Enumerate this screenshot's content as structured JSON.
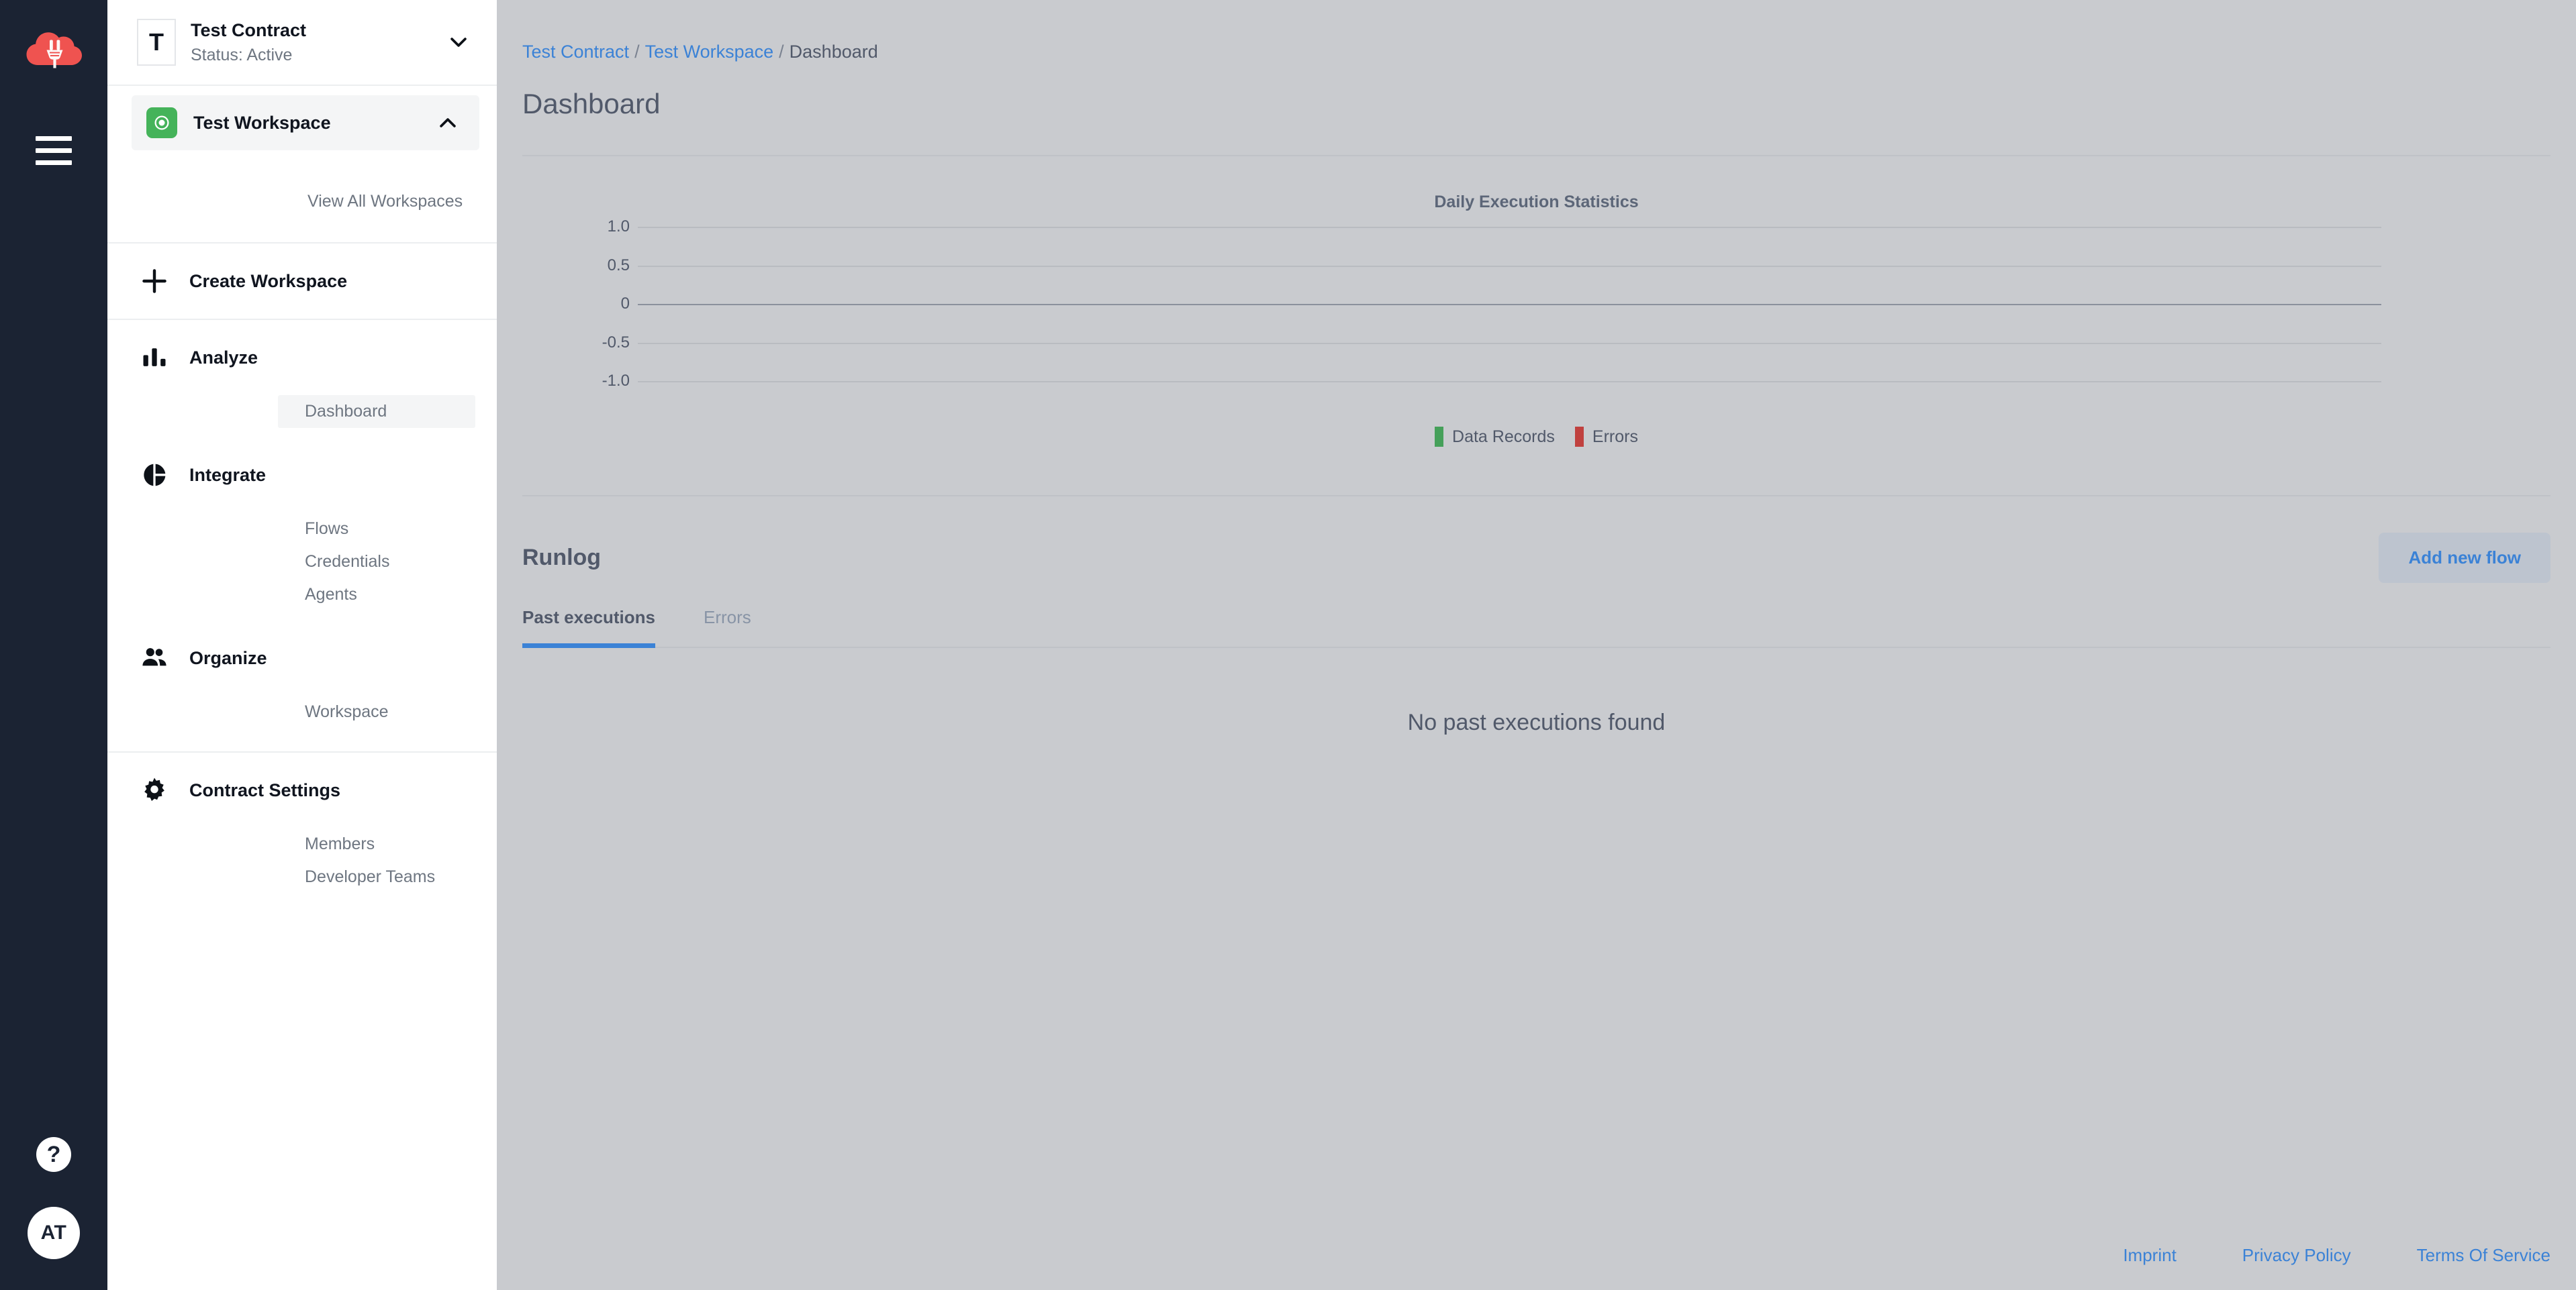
{
  "rail": {
    "logo_icon": "cloud-plug-logo-icon",
    "menu_icon": "hamburger-menu-icon",
    "help_label": "?",
    "avatar_initials": "AT"
  },
  "sidebar": {
    "contract": {
      "initial": "T",
      "name": "Test Contract",
      "status": "Status: Active",
      "chevron": "chevron-down-icon"
    },
    "workspace": {
      "name": "Test Workspace",
      "chevron": "chevron-up-icon",
      "view_all_label": "View All Workspaces",
      "create_label": "Create Workspace"
    },
    "sections": [
      {
        "label": "Analyze",
        "icon": "bar-chart-icon",
        "items": [
          {
            "label": "Dashboard",
            "active": true
          }
        ]
      },
      {
        "label": "Integrate",
        "icon": "pie-chart-icon",
        "items": [
          {
            "label": "Flows",
            "active": false
          },
          {
            "label": "Credentials",
            "active": false
          },
          {
            "label": "Agents",
            "active": false
          }
        ]
      },
      {
        "label": "Organize",
        "icon": "people-icon",
        "items": [
          {
            "label": "Workspace",
            "active": false
          }
        ]
      },
      {
        "label": "Contract Settings",
        "icon": "gear-icon",
        "items": [
          {
            "label": "Members",
            "active": false
          },
          {
            "label": "Developer Teams",
            "active": false
          }
        ]
      }
    ]
  },
  "breadcrumb": {
    "items": [
      "Test Contract",
      "Test Workspace",
      "Dashboard"
    ],
    "separator": "/"
  },
  "page": {
    "title": "Dashboard"
  },
  "chart_data": {
    "type": "bar",
    "title": "Daily Execution Statistics",
    "categories": [],
    "series": [
      {
        "name": "Data Records",
        "values": [],
        "color": "#45a05a"
      },
      {
        "name": "Errors",
        "values": [],
        "color": "#c0413f"
      }
    ],
    "xlabel": "",
    "ylabel": "",
    "ylim": [
      -1.0,
      1.0
    ],
    "yticks": [
      "1.0",
      "0.5",
      "0",
      "-0.5",
      "-1.0"
    ],
    "ytick_values": [
      1.0,
      0.5,
      0,
      -0.5,
      -1.0
    ],
    "grid": true,
    "legend_position": "bottom",
    "empty": true
  },
  "runlog": {
    "title": "Runlog",
    "add_button_label": "Add new flow",
    "tabs": [
      {
        "label": "Past executions",
        "active": true
      },
      {
        "label": "Errors",
        "active": false
      }
    ],
    "empty_message": "No past executions found"
  },
  "footer": {
    "links": [
      "Imprint",
      "Privacy Policy",
      "Terms Of Service"
    ]
  },
  "colors": {
    "accent_blue": "#3b82d6",
    "brand_red": "#ef5350",
    "workspace_green": "#45b35a",
    "rail_dark": "#1b2333",
    "data_records_green": "#45a05a",
    "errors_red": "#c0413f",
    "main_bg": "#c9cbcf"
  }
}
